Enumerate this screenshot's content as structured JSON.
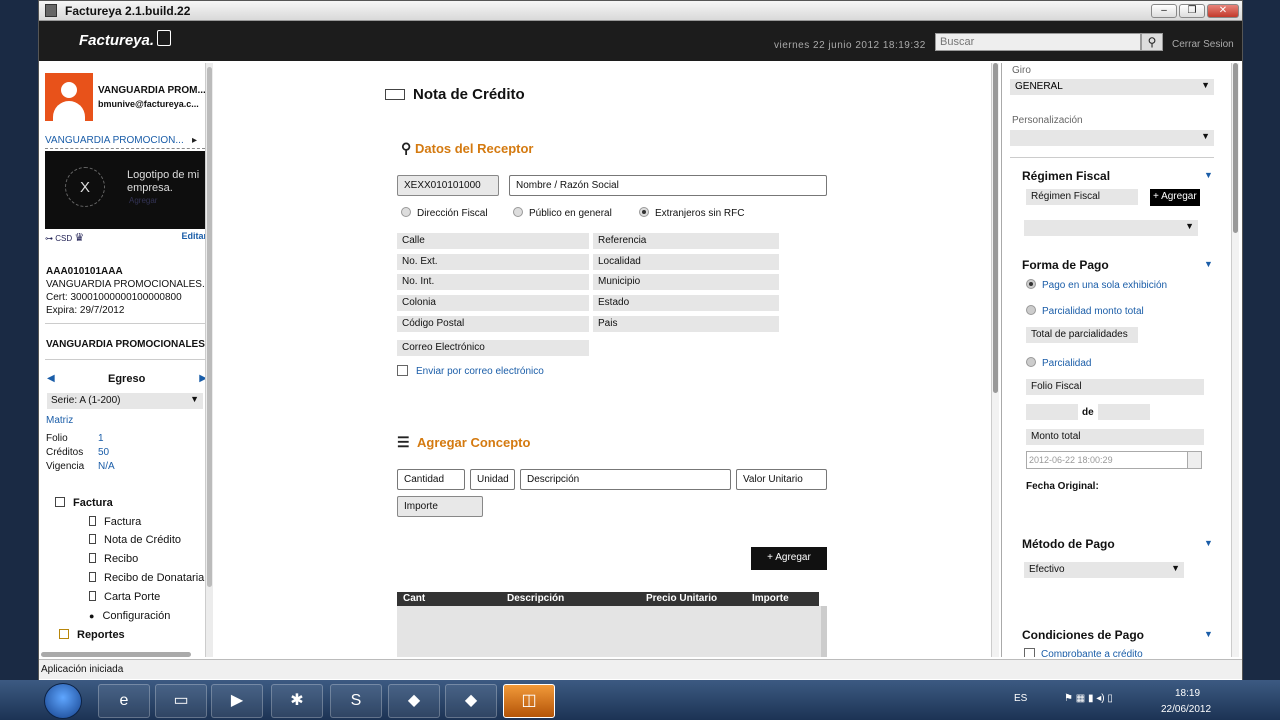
{
  "window": {
    "title": "Factureya 2.1.build.22",
    "min": "–",
    "max": "❐",
    "close": "✕"
  },
  "header": {
    "logo": "Factureya.",
    "date": "viernes 22 junio 2012 18:19:32",
    "search_placeholder": "Buscar",
    "logout": "Cerrar Sesion"
  },
  "sidebar": {
    "user_name": "VANGUARDIA PROM...",
    "user_email": "bmunive@factureya.c...",
    "company": "VANGUARDIA PROMOCION...",
    "logo_x": "X",
    "logo_text": "Logotipo de mi empresa.",
    "logo_link": "Agregar",
    "csd": "CSD",
    "edit": "Editar",
    "rfc": "AAA010101AAA",
    "razon": "VANGUARDIA PROMOCIONALES...",
    "cert": "Cert:  30001000000100000800",
    "expira": "Expira:  29/7/2012",
    "company_full": "VANGUARDIA PROMOCIONALES",
    "egreso": "Egreso",
    "serie": "Serie: A (1-200)",
    "matriz": "Matriz",
    "folio_label": "Folio",
    "folio": "1",
    "creditos_label": "Créditos",
    "creditos": "50",
    "vigencia_label": "Vigencia",
    "vigencia": "N/A",
    "tree": {
      "factura_group": "Factura",
      "items": [
        "Factura",
        "Nota de Crédito",
        "Recibo",
        "Recibo de Donataria",
        "Carta Porte",
        "Configuración"
      ],
      "reportes": "Reportes"
    }
  },
  "main": {
    "title": "Nota de Crédito",
    "receptor_title": "Datos del Receptor",
    "rfc_value": "XEXX010101000",
    "nombre_placeholder": "Nombre / Razón Social",
    "radios": [
      "Dirección Fiscal",
      "Público en general",
      "Extranjeros sin RFC"
    ],
    "selected_radio": "Extranjeros sin RFC",
    "fields_left": [
      "Calle",
      "No. Ext.",
      "No. Int.",
      "Colonia",
      "Código Postal",
      "Correo Electrónico"
    ],
    "fields_right": [
      "Referencia",
      "Localidad",
      "Municipio",
      "Estado",
      "Pais"
    ],
    "send_email": "Enviar por correo electrónico",
    "concepto_title": "Agregar Concepto",
    "cantidad": "Cantidad",
    "unidad": "Unidad",
    "descripcion": "Descripción",
    "valor_unitario": "Valor Unitario",
    "importe": "Importe",
    "add_button": "+ Agregar",
    "table_headers": [
      "Cant",
      "Descripción",
      "Precio Unitario",
      "Importe"
    ]
  },
  "right": {
    "giro_label": "Giro",
    "giro": "GENERAL",
    "personalizacion_label": "Personalización",
    "personalizacion": "",
    "regimen_title": "Régimen Fiscal",
    "regimen_placeholder": "Régimen Fiscal",
    "regimen_add": "+ Agregar",
    "forma_title": "Forma de Pago",
    "forma_options": [
      "Pago en una sola exhibición",
      "Parcialidad monto total",
      "Parcialidad"
    ],
    "total_parcialidades": "Total de parcialidades",
    "folio_fiscal": "Folio Fiscal",
    "de": "de",
    "monto_total": "Monto total",
    "fecha_value": "2012-06-22 18:00:29",
    "fecha_original": "Fecha Original:",
    "metodo_title": "Método de Pago",
    "metodo": "Efectivo",
    "condiciones_title": "Condiciones de Pago",
    "condiciones_option": "Comprobante a crédito"
  },
  "status": {
    "text": "Aplicación iniciada"
  },
  "taskbar": {
    "lang": "ES",
    "time": "18:19",
    "date": "22/06/2012"
  }
}
